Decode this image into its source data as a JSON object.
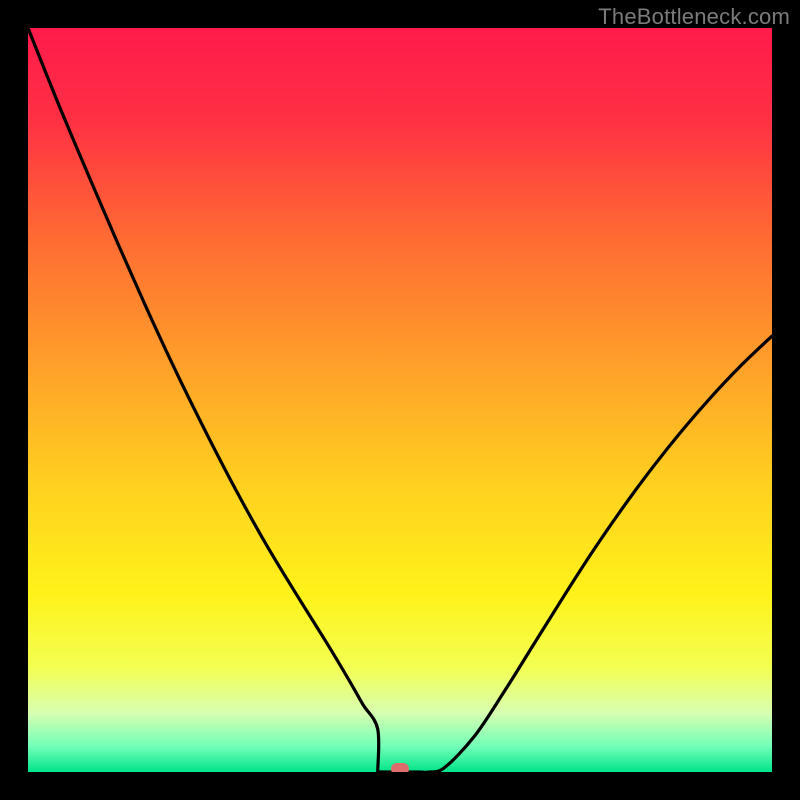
{
  "watermark": "TheBottleneck.com",
  "chart_data": {
    "type": "line",
    "title": "",
    "xlabel": "",
    "ylabel": "",
    "xlim": [
      0,
      1
    ],
    "ylim": [
      0,
      1
    ],
    "gradient_stops": [
      {
        "offset": 0.0,
        "color": "#ff1b4b"
      },
      {
        "offset": 0.12,
        "color": "#ff2f44"
      },
      {
        "offset": 0.28,
        "color": "#ff6a33"
      },
      {
        "offset": 0.45,
        "color": "#ff9f2a"
      },
      {
        "offset": 0.62,
        "color": "#ffd21f"
      },
      {
        "offset": 0.76,
        "color": "#fff21a"
      },
      {
        "offset": 0.86,
        "color": "#f3ff52"
      },
      {
        "offset": 0.92,
        "color": "#d8ffb0"
      },
      {
        "offset": 0.965,
        "color": "#74ffb8"
      },
      {
        "offset": 1.0,
        "color": "#00e58a"
      }
    ],
    "series": [
      {
        "name": "bottleneck-curve",
        "x": [
          0.0,
          0.04,
          0.08,
          0.12,
          0.16,
          0.2,
          0.24,
          0.28,
          0.32,
          0.36,
          0.4,
          0.43,
          0.45,
          0.47,
          0.485,
          0.5,
          0.52,
          0.54,
          0.56,
          0.6,
          0.64,
          0.68,
          0.72,
          0.76,
          0.8,
          0.84,
          0.88,
          0.92,
          0.96,
          1.0
        ],
        "y": [
          1.0,
          0.9,
          0.805,
          0.712,
          0.622,
          0.536,
          0.455,
          0.378,
          0.306,
          0.24,
          0.176,
          0.126,
          0.091,
          0.058,
          0.033,
          0.014,
          0.003,
          0.0,
          0.006,
          0.048,
          0.108,
          0.172,
          0.236,
          0.298,
          0.356,
          0.41,
          0.46,
          0.506,
          0.548,
          0.586
        ]
      }
    ],
    "flat_segment": {
      "x_start": 0.47,
      "x_end": 0.525,
      "y": 0.0
    },
    "marker": {
      "x": 0.5,
      "y": 0.0,
      "color": "#de6e6b"
    }
  }
}
